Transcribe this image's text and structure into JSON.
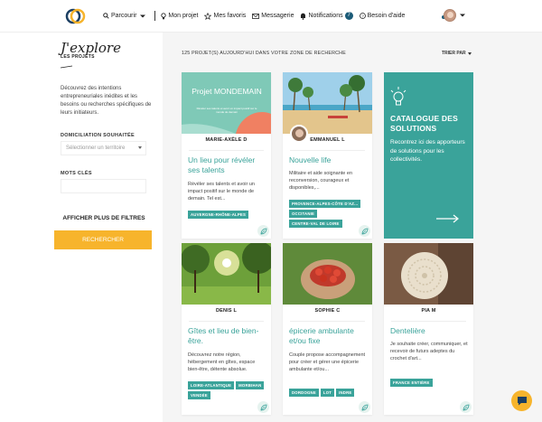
{
  "header": {
    "nav": [
      {
        "label": "Parcourir",
        "icon": "search-icon"
      },
      {
        "label": "Mon projet",
        "icon": "lightbulb-icon"
      },
      {
        "label": "Mes favoris",
        "icon": "star-icon"
      },
      {
        "label": "Messagerie",
        "icon": "mail-icon"
      },
      {
        "label": "Notifications",
        "icon": "bell-icon",
        "badge": "7"
      },
      {
        "label": "Besoin d'aide",
        "icon": "help-icon"
      }
    ]
  },
  "sidebar": {
    "title": "J'explore",
    "subtitle": "LES PROJETS",
    "description": "Découvrez des intentions entrepreneuriales inédites et les besoins ou recherches spécifiques de leurs initiateurs.",
    "domiciliation_label": "DOMICILIATION SOUHAITÉE",
    "territory_placeholder": "Sélectionner un territoire",
    "keywords_label": "MOTS CLÉS",
    "more_filters": "AFFICHER PLUS DE FILTRES",
    "search_button": "RECHERCHER"
  },
  "results": {
    "count_text": "125 PROJET(S) AUJOURD'HUI DANS VOTRE ZONE DE RECHERCHE",
    "sort_label": "TRIER PAR"
  },
  "cards": [
    {
      "author": "MARIE-AXÈLE D",
      "title": "Un lieu pour révéler ses talents",
      "desc": "Révéler ses talents et avoir un impact positif sur le monde de demain. Tel est...",
      "tags": [
        "AUVERGNE-RHÔNE-ALPES"
      ],
      "image_text_title": "Projet MONDEMAIN",
      "image_text_sub": "Révéler ses talents et avoir un impact positif sur le monde de demain"
    },
    {
      "author": "EMMANUEL L",
      "title": "Nouvelle life",
      "desc": "Militaire et aide soignante en reconversion, courageux et disponibles,...",
      "tags": [
        "PROVENCE-ALPES-CÔTE D'AZ...",
        "OCCITANIE",
        "CENTRE-VAL DE LOIRE"
      ]
    },
    {
      "author": "DENIS L",
      "title": "Gîtes et lieu de bien-être.",
      "desc": "Découvrez notre région, hébergement en gîtes, espace bien-être, détente absolue.",
      "tags": [
        "LOIRE-ATLANTIQUE",
        "MORBIHAN",
        "VENDÉE"
      ]
    },
    {
      "author": "SOPHIE C",
      "title": "épicerie ambulante et/ou fixe",
      "desc": "Couple propose accompagnement pour créer et gérer une épicerie ambulante et/ou...",
      "tags": [
        "DORDOGNE",
        "LOT",
        "INDRE"
      ]
    },
    {
      "author": "PIA M",
      "title": "Dentelière",
      "desc": "Je souhaite créer, communiquer, et recevoir de futurs adeptes du crochet d'art...",
      "tags": [
        "FRANCE ENTIÈRE"
      ]
    }
  ],
  "catalogue": {
    "title": "CATALOGUE DES SOLUTIONS",
    "desc": "Recontrez ici des apporteurs de solutions pour les collectivités."
  },
  "colors": {
    "accent": "#3aa39a",
    "cta": "#f7b42c",
    "badge": "#1c5c78"
  }
}
